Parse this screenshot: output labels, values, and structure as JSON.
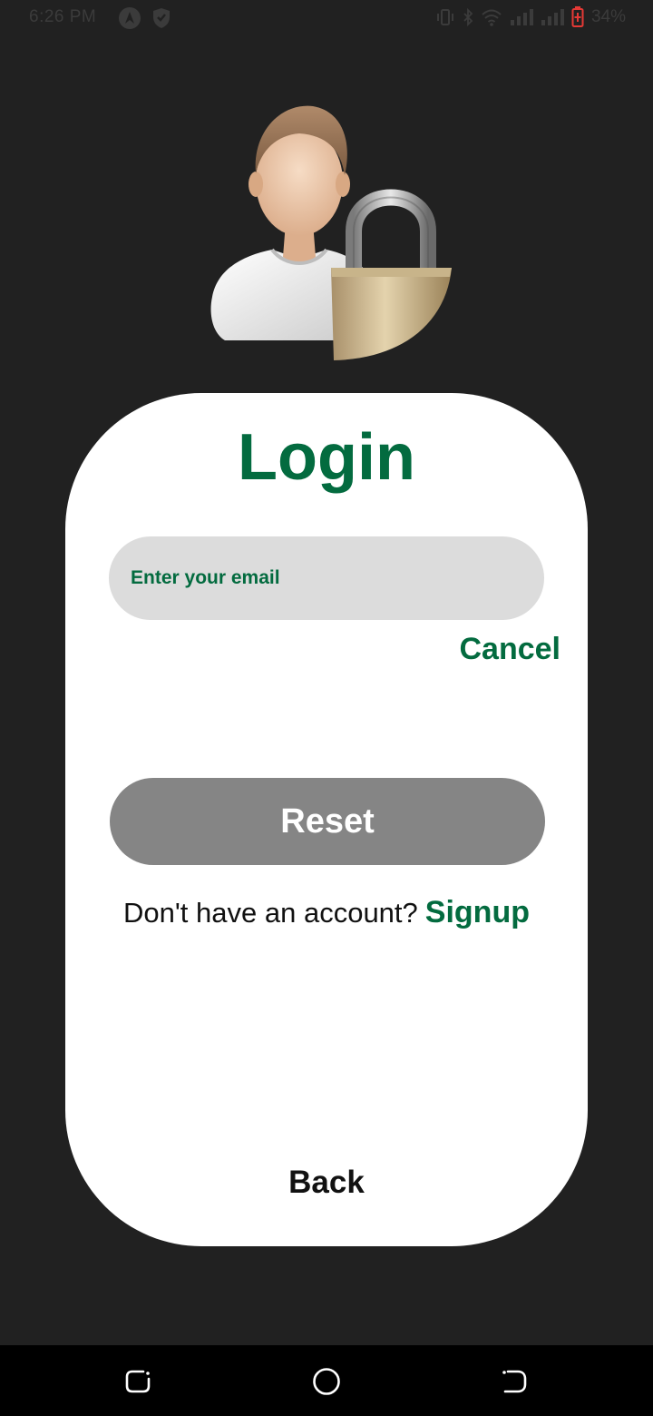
{
  "status_bar": {
    "time": "6:26 PM",
    "battery": "34%",
    "icons": [
      "navigation-a-icon",
      "shield-icon",
      "vibrate-icon",
      "bluetooth-icon",
      "wifi-icon",
      "signal-icon",
      "signal-icon",
      "battery-charging-icon"
    ]
  },
  "hero": {
    "icon": "user-lock-icon"
  },
  "login": {
    "title": "Login",
    "email_placeholder": "Enter your email",
    "cancel_label": "Cancel",
    "reset_label": "Reset",
    "no_account_text": "Don't have an account?",
    "signup_label": "Signup",
    "back_label": "Back"
  },
  "nav_bar": {
    "icons": [
      "recent-apps-icon",
      "home-icon",
      "back-icon"
    ]
  },
  "colors": {
    "accent": "#036b3f",
    "background": "#212121",
    "card": "#ffffff",
    "input_bg": "#dcdcdc",
    "button_bg": "#858585"
  }
}
